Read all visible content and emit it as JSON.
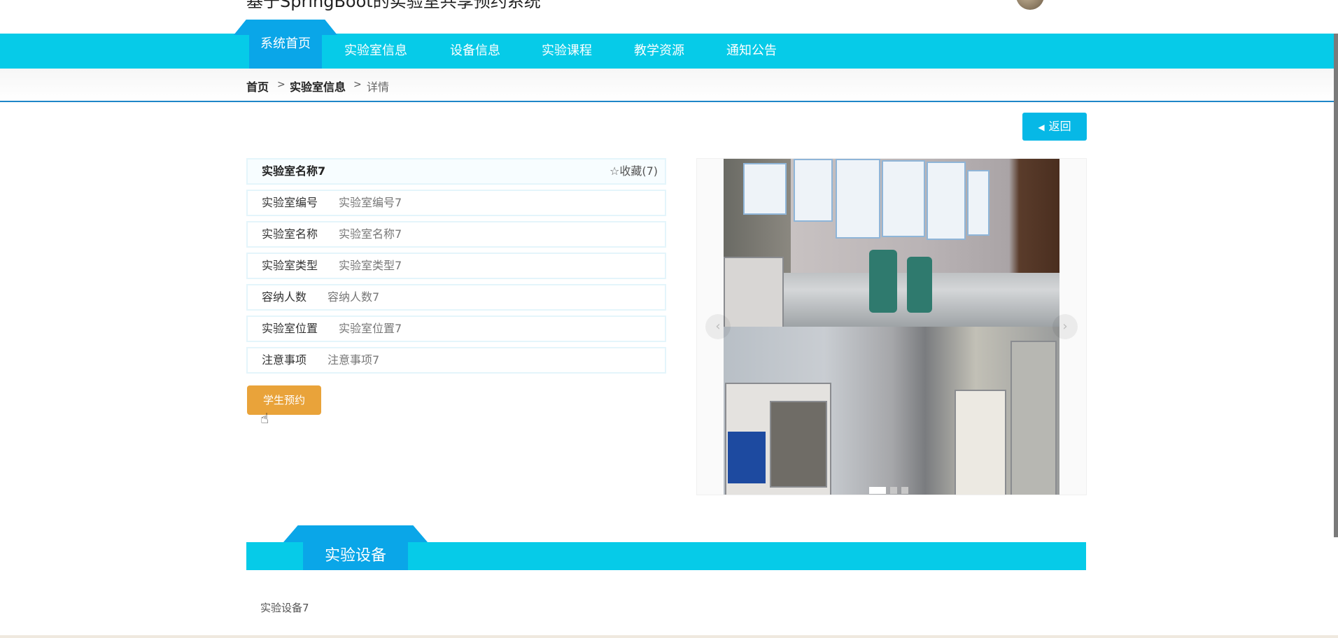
{
  "site": {
    "title": "基于SpringBoot的实验室共享预约系统"
  },
  "nav": {
    "home": "系统首页",
    "items": [
      "实验室信息",
      "设备信息",
      "实验课程",
      "教学资源",
      "通知公告"
    ]
  },
  "breadcrumb": {
    "home": "首页",
    "section": "实验室信息",
    "current": "详情",
    "separator": ">"
  },
  "back_button": {
    "label": "返回"
  },
  "detail": {
    "title": "实验室名称7",
    "favorite": "☆收藏(7)",
    "rows": [
      {
        "label": "实验室编号",
        "value": "实验室编号7"
      },
      {
        "label": "实验室名称",
        "value": "实验室名称7"
      },
      {
        "label": "实验室类型",
        "value": "实验室类型7"
      },
      {
        "label": "容纳人数",
        "value": "容纳人数7"
      },
      {
        "label": "实验室位置",
        "value": "实验室位置7"
      },
      {
        "label": "注意事项",
        "value": "注意事项7"
      }
    ]
  },
  "reserve_button": {
    "label": "学生预约"
  },
  "carousel": {
    "slide_count": 3,
    "active_slide": 1
  },
  "section": {
    "title": "实验设备",
    "content": "实验设备7"
  },
  "colors": {
    "nav": "#06cbe8",
    "accent": "#0aa6e8",
    "reserve": "#e9a33a"
  }
}
